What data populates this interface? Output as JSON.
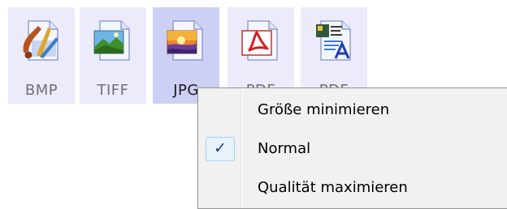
{
  "file_types": [
    {
      "label": "BMP",
      "icon": "bmp-file-icon",
      "selected": false
    },
    {
      "label": "TIFF",
      "icon": "tiff-file-icon",
      "selected": false
    },
    {
      "label": "JPG",
      "icon": "jpg-file-icon",
      "selected": true
    },
    {
      "label": "PDF",
      "icon": "pdf-file-icon",
      "selected": false
    },
    {
      "label": "PDF",
      "icon": "searchable-pdf-file-icon",
      "selected": false
    }
  ],
  "context_menu": {
    "items": [
      {
        "label": "Größe minimieren",
        "checked": false
      },
      {
        "label": "Normal",
        "checked": true
      },
      {
        "label": "Qualität maximieren",
        "checked": false
      }
    ],
    "check_glyph": "✓"
  },
  "colors": {
    "tile_bg": "#ecebfb",
    "tile_selected_bg": "#cdd0f5",
    "menu_bg": "#f1f1f1",
    "check_color": "#1d3a86"
  }
}
